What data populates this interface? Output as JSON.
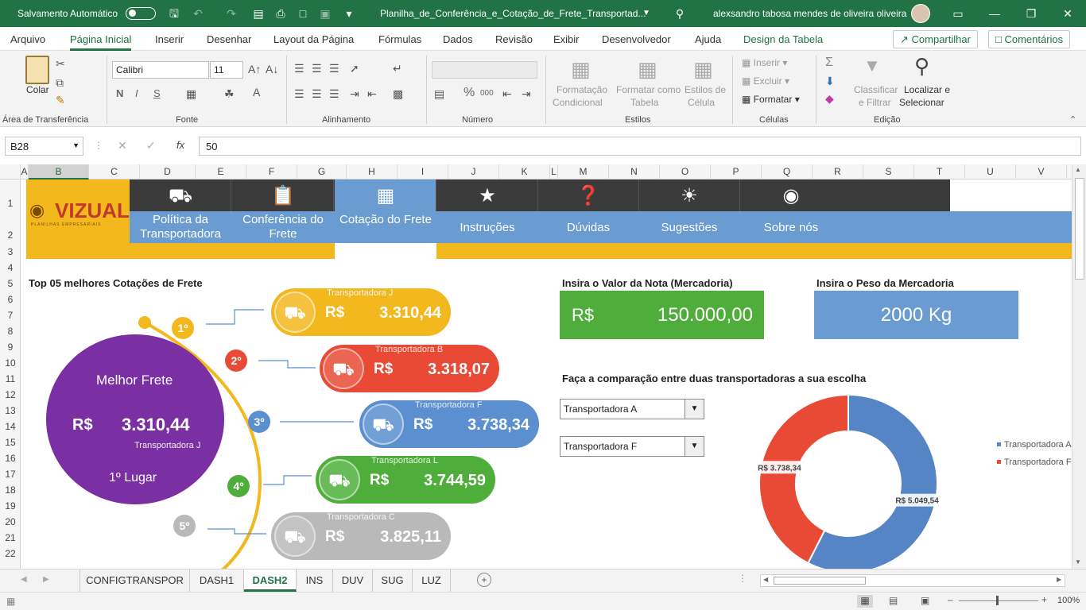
{
  "titlebar": {
    "autosave_label": "Salvamento Automático",
    "doc_title": "Planilha_de_Conferência_e_Cotação_de_Frete_Transportad...",
    "user_name": "alexsandro tabosa mendes de oliveira oliveira"
  },
  "menu": {
    "items": [
      "Arquivo",
      "Página Inicial",
      "Inserir",
      "Desenhar",
      "Layout da Página",
      "Fórmulas",
      "Dados",
      "Revisão",
      "Exibir",
      "Desenvolvedor",
      "Ajuda",
      "Design da Tabela"
    ],
    "share": "Compartilhar",
    "comments": "Comentários"
  },
  "ribbon": {
    "paste_label": "Colar",
    "clipboard_group": "Área de Transferência",
    "font_name": "Calibri",
    "font_size": "11",
    "font_group": "Fonte",
    "bold": "N",
    "italic": "I",
    "underline": "S",
    "align_group": "Alinhamento",
    "number_group": "Número",
    "percent": "%",
    "thousands": "000",
    "cond_format_1": "Formatação",
    "cond_format_2": "Condicional",
    "table_format_1": "Formatar como",
    "table_format_2": "Tabela",
    "cell_styles_1": "Estilos de",
    "cell_styles_2": "Célula",
    "styles_group": "Estilos",
    "insert": "Inserir",
    "delete": "Excluir",
    "format": "Formatar",
    "cells_group": "Células",
    "sort_1": "Classificar",
    "sort_2": "e Filtrar",
    "find_1": "Localizar e",
    "find_2": "Selecionar",
    "edit_group": "Edição"
  },
  "formula_bar": {
    "name_box": "B28",
    "fx": "fx",
    "value": "50"
  },
  "columns": [
    "A",
    "B",
    "C",
    "D",
    "E",
    "F",
    "G",
    "H",
    "I",
    "J",
    "K",
    "L",
    "M",
    "N",
    "O",
    "P",
    "Q",
    "R",
    "S",
    "T",
    "U",
    "V"
  ],
  "rows": [
    "1",
    "2",
    "3",
    "4",
    "5",
    "6",
    "7",
    "8",
    "9",
    "10",
    "11",
    "12",
    "13",
    "14",
    "15",
    "16",
    "17",
    "18",
    "19",
    "20",
    "21",
    "22"
  ],
  "dashboard": {
    "logo_text": "VIZUAL",
    "logo_sub": "PLANILHAS EMPRESARIAIS",
    "nav": [
      {
        "label": "Política da Transportadora",
        "icon": "truck-icon"
      },
      {
        "label": "Conferência do Frete",
        "icon": "clipboard-icon"
      },
      {
        "label": "Cotação do Frete",
        "icon": "strategy-board-icon"
      },
      {
        "label": "Instruções",
        "icon": "teacher-icon"
      },
      {
        "label": "Dúvidas",
        "icon": "question-people-icon"
      },
      {
        "label": "Sugestões",
        "icon": "lightbulb-icon"
      },
      {
        "label": "Sobre nós",
        "icon": "owl-icon"
      }
    ],
    "top5_title": "Top 05 melhores Cotações de Frete",
    "best": {
      "title": "Melhor Frete",
      "currency": "R$",
      "value": "3.310,44",
      "carrier": "Transportadora J",
      "place": "1º Lugar"
    },
    "ranking": [
      {
        "rank": "1º",
        "carrier": "Transportadora J",
        "currency": "R$",
        "value": "3.310,44",
        "color": "#f2b81e"
      },
      {
        "rank": "2º",
        "carrier": "Transportadora B",
        "currency": "R$",
        "value": "3.318,07",
        "color": "#e84a35"
      },
      {
        "rank": "3º",
        "carrier": "Transportadora F",
        "currency": "R$",
        "value": "3.738,34",
        "color": "#5b8fd0"
      },
      {
        "rank": "4º",
        "carrier": "Transportadora L",
        "currency": "R$",
        "value": "3.744,59",
        "color": "#4fae3b"
      },
      {
        "rank": "5º",
        "carrier": "Transportadora C",
        "currency": "R$",
        "value": "3.825,11",
        "color": "#b9b9b9"
      }
    ],
    "invoice": {
      "title": "Insira o Valor da Nota (Mercadoria)",
      "currency": "R$",
      "value": "150.000,00"
    },
    "weight": {
      "title": "Insira o Peso da Mercadoria",
      "value": "2000 Kg"
    },
    "compare_title": "Faça a comparação entre duas transportadoras a sua escolha",
    "select_a": "Transportadora A",
    "select_b": "Transportadora F"
  },
  "chart_data": {
    "type": "pie",
    "donut": true,
    "categories": [
      "Transportadora A",
      "Transportadora F"
    ],
    "values": [
      5049.54,
      3738.34
    ],
    "data_labels": [
      "R$ 5.049,54",
      "R$ 3.738,34"
    ],
    "colors": [
      "#5585c5",
      "#e84a35"
    ],
    "legend": "right"
  },
  "tabs": [
    "CONFIGTRANSPOR",
    "DASH1",
    "DASH2",
    "INS",
    "DUV",
    "SUG",
    "LUZ"
  ],
  "active_tab": "DASH2",
  "status": {
    "zoom": "100%"
  }
}
